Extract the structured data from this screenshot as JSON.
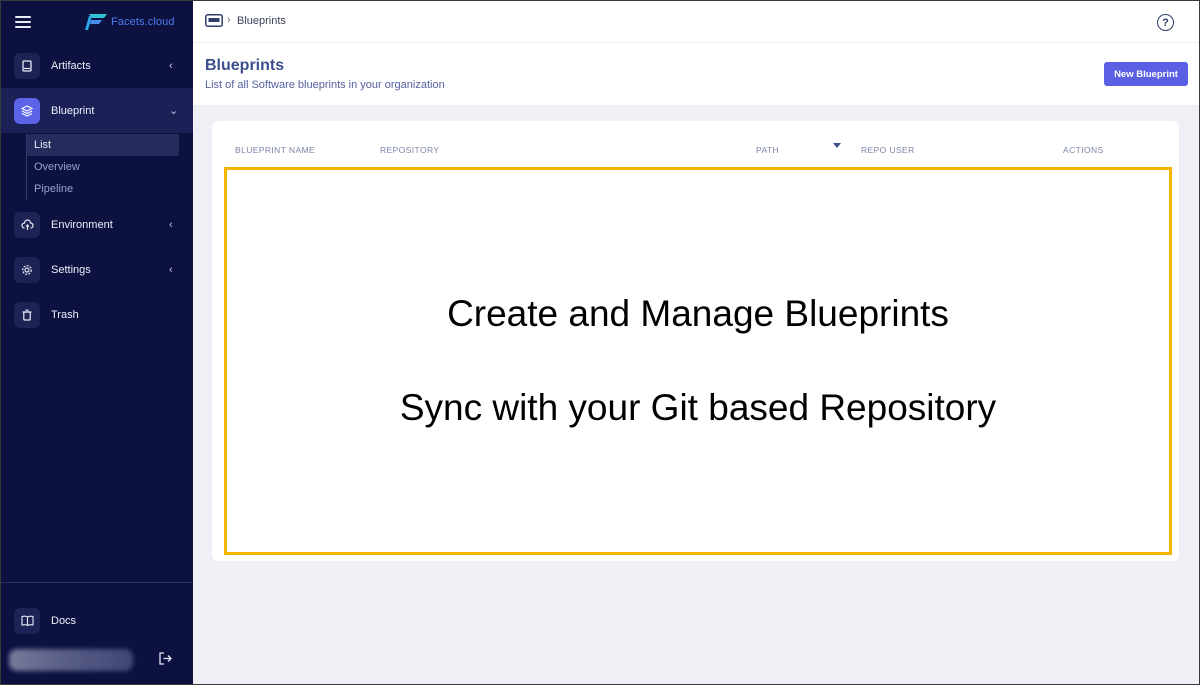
{
  "app": {
    "brand": "Facets.cloud"
  },
  "sidebar": {
    "items": [
      {
        "label": "Artifacts",
        "icon": "book-icon",
        "chevron": "‹"
      },
      {
        "label": "Blueprint",
        "icon": "layers-icon",
        "chevron": "⌄"
      },
      {
        "label": "Environment",
        "icon": "cloud-upload-icon",
        "chevron": "‹"
      },
      {
        "label": "Settings",
        "icon": "gear-icon",
        "chevron": "‹"
      },
      {
        "label": "Trash",
        "icon": "trash-icon"
      }
    ],
    "sub_items": [
      {
        "label": "List"
      },
      {
        "label": "Overview"
      },
      {
        "label": "Pipeline"
      }
    ],
    "docs": {
      "label": "Docs",
      "icon": "open-book-icon"
    }
  },
  "breadcrumb": {
    "separator": "›",
    "current": "Blueprints"
  },
  "header": {
    "title": "Blueprints",
    "subtitle": "List of all Software blueprints in your organization",
    "new_button": "New Blueprint"
  },
  "table": {
    "columns": [
      "BLUEPRINT NAME",
      "REPOSITORY",
      "PATH",
      "REPO USER",
      "ACTIONS"
    ]
  },
  "overlay": {
    "line1": "Create and Manage Blueprints",
    "line2": "Sync with your Git based Repository",
    "border_color": "#f4b400"
  },
  "colors": {
    "sidebar_bg": "#0c1140",
    "accent": "#5b5fe3",
    "title": "#3b4f8e"
  }
}
